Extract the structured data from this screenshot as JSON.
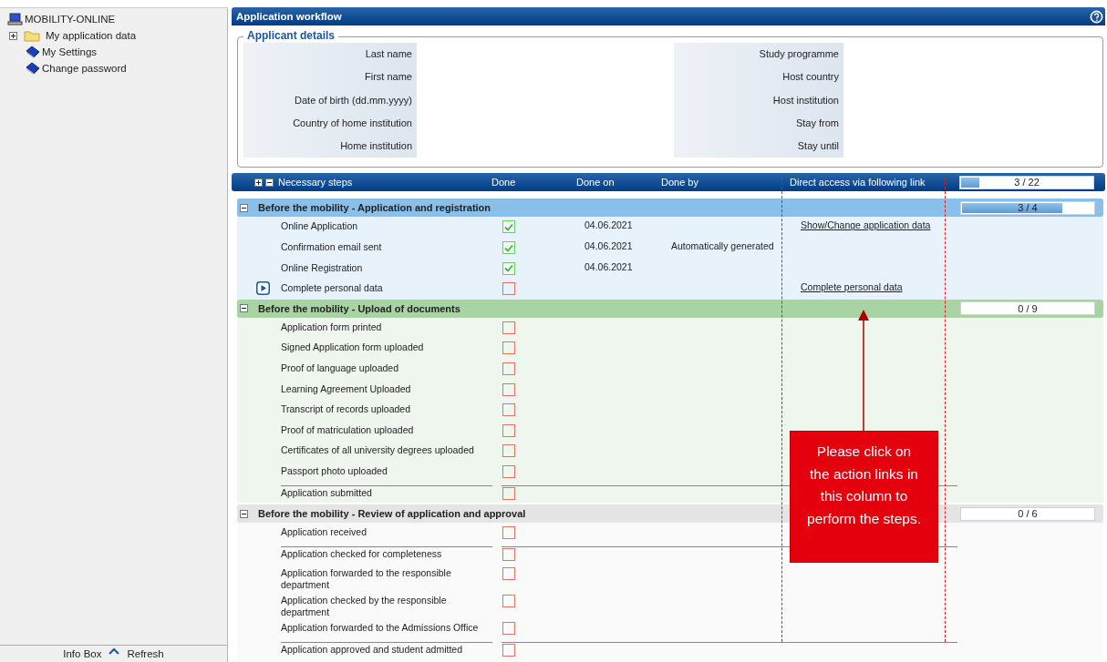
{
  "sidebar": {
    "root": "MOBILITY-ONLINE",
    "items": [
      {
        "label": "My application data",
        "kind": "folder",
        "expanded": false
      },
      {
        "label": "My Settings",
        "kind": "book"
      },
      {
        "label": "Change password",
        "kind": "book"
      }
    ],
    "footer": {
      "info_box": "Info Box",
      "refresh": "Refresh"
    }
  },
  "window": {
    "title": "Application workflow"
  },
  "applicant_details": {
    "title": "Applicant details",
    "left_fields": [
      "Last name",
      "First name",
      "Date of birth (dd.mm.yyyy)",
      "Country of home institution",
      "Home institution"
    ],
    "right_fields": [
      "Study programme",
      "Host country",
      "Host institution",
      "Stay from",
      "Stay until"
    ]
  },
  "steps_header": {
    "columns": [
      "Necessary steps",
      "Done",
      "Done on",
      "Done by",
      "Direct access via following link"
    ],
    "progress": "3 / 22",
    "level": 0.136
  },
  "groups": [
    {
      "title": "Before the mobility - Application and registration",
      "color": "#89bfe9",
      "progress": "3 / 4",
      "level": 0.75,
      "steps": [
        {
          "name": "Online Application",
          "done": true,
          "done_on": "04.06.2021",
          "link": "Show/Change application data",
          "current": false,
          "divider": false
        },
        {
          "name": "Confirmation email sent",
          "done": true,
          "done_on": "04.06.2021",
          "done_by": "Automatically generated",
          "current": false,
          "divider": false
        },
        {
          "name": "Online Registration",
          "done": true,
          "done_on": "04.06.2021",
          "current": false,
          "divider": false
        },
        {
          "name": "Complete personal data",
          "done": false,
          "link": "Complete personal data",
          "current": true,
          "divider": false
        }
      ]
    },
    {
      "title": "Before the mobility - Upload of documents",
      "color": "#a8d4a3",
      "progress": "0 / 9",
      "level": 0,
      "steps": [
        {
          "name": "Application form printed",
          "done": false,
          "current": false,
          "divider": false
        },
        {
          "name": "Signed Application form uploaded",
          "done": false,
          "current": false,
          "divider": false
        },
        {
          "name": "Proof of language uploaded",
          "done": false,
          "current": false,
          "divider": false
        },
        {
          "name": "Learning Agreement Uploaded",
          "done": false,
          "current": false,
          "divider": false
        },
        {
          "name": "Transcript of records uploaded",
          "done": false,
          "current": false,
          "divider": false
        },
        {
          "name": "Proof of matriculation uploaded",
          "done": false,
          "current": false,
          "divider": false
        },
        {
          "name": "Certificates of all university degrees uploaded",
          "done": false,
          "current": false,
          "divider": false
        },
        {
          "name": "Passport photo uploaded",
          "done": false,
          "current": false,
          "divider": false
        },
        {
          "name": "Application submitted",
          "done": false,
          "current": false,
          "divider": true
        }
      ]
    },
    {
      "title": "Before the mobility - Review of application and approval",
      "color": "#e4e4e4",
      "progress": "0 / 6",
      "level": 0,
      "steps": [
        {
          "name": "Application received",
          "done": false,
          "current": false,
          "divider": false
        },
        {
          "name": "Application checked for completeness",
          "done": false,
          "current": false,
          "divider": true
        },
        {
          "name": "Application forwarded to the responsible department",
          "done": false,
          "current": false,
          "divider": false
        },
        {
          "name": "Application checked by the responsible department",
          "done": false,
          "current": false,
          "divider": false
        },
        {
          "name": "Application forwarded to the Admissions Office",
          "done": false,
          "current": false,
          "divider": false
        },
        {
          "name": "Application approved and student admitted",
          "done": false,
          "current": false,
          "divider": true
        }
      ]
    }
  ],
  "annotation": {
    "text": "Please click on the action links in this column to perform the steps."
  }
}
